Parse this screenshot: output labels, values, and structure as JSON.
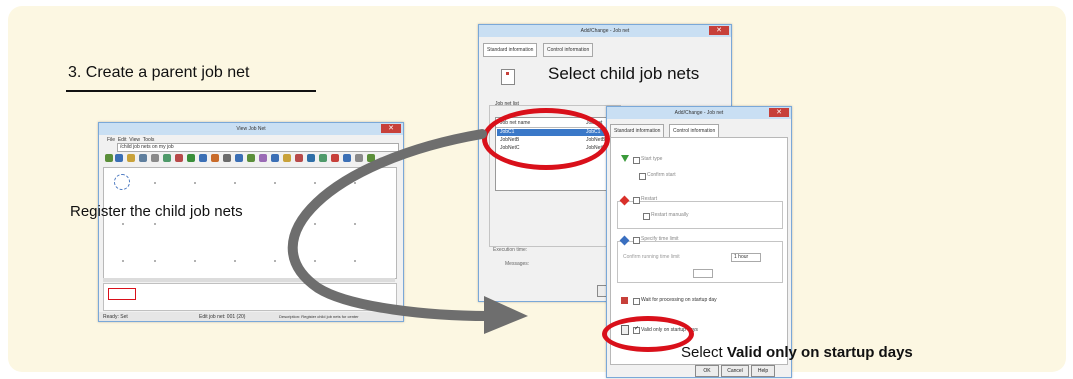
{
  "step": {
    "title": "3. Create a parent job net"
  },
  "captions": {
    "register": "Register the child job nets",
    "select_child": "Select child job nets",
    "valid_prefix": "Select ",
    "valid_bold": "Valid",
    "valid_suffix": " only on startup days"
  },
  "colors": {
    "panel_bg": "#fcf7e2",
    "window_border": "#7aa8d8",
    "highlight_red": "#d9101a",
    "arrow_gray": "#6e6e6e"
  },
  "main_window": {
    "title": "View Job Net",
    "menu": [
      "File",
      "Edit",
      "View",
      "Tools"
    ],
    "path": "/child job nets on my job",
    "status_left": "Ready: Set",
    "status_mid": "Edit job net: 001 (20)",
    "status_right": "Description: Register child job nets for center"
  },
  "dialog_add": {
    "title": "Add/Change - Job net",
    "tab_standard": "Standard information",
    "tab_control": "Control information",
    "section_label": "Job net list",
    "columns": [
      "Job net name",
      "Job net"
    ],
    "rows": [
      [
        "JobC1",
        "JobC1"
      ],
      [
        "JobNetB",
        "JobNetB"
      ],
      [
        "JobNetC",
        "JobNetC"
      ]
    ],
    "field_a": "Execution time:",
    "field_b": "Messages:"
  },
  "dialog_control": {
    "title": "Add/Change - Job net",
    "tab_standard": "Standard information",
    "tab_control": "Control information",
    "opt_start_type": "Start type",
    "opt_confirm": "Confirm start",
    "opt_restart": "Restart",
    "opt_restart_sub": "Restart manually",
    "opt_monitor": "Specify time limit",
    "opt_monitor_field": "Confirm running time limit",
    "opt_monitor_unit": "1 hour",
    "opt_wait": "Wait for processing on startup day",
    "opt_valid": "Valid only on startup days",
    "btn_ok": "OK",
    "btn_cancel": "Cancel",
    "btn_help": "Help"
  }
}
